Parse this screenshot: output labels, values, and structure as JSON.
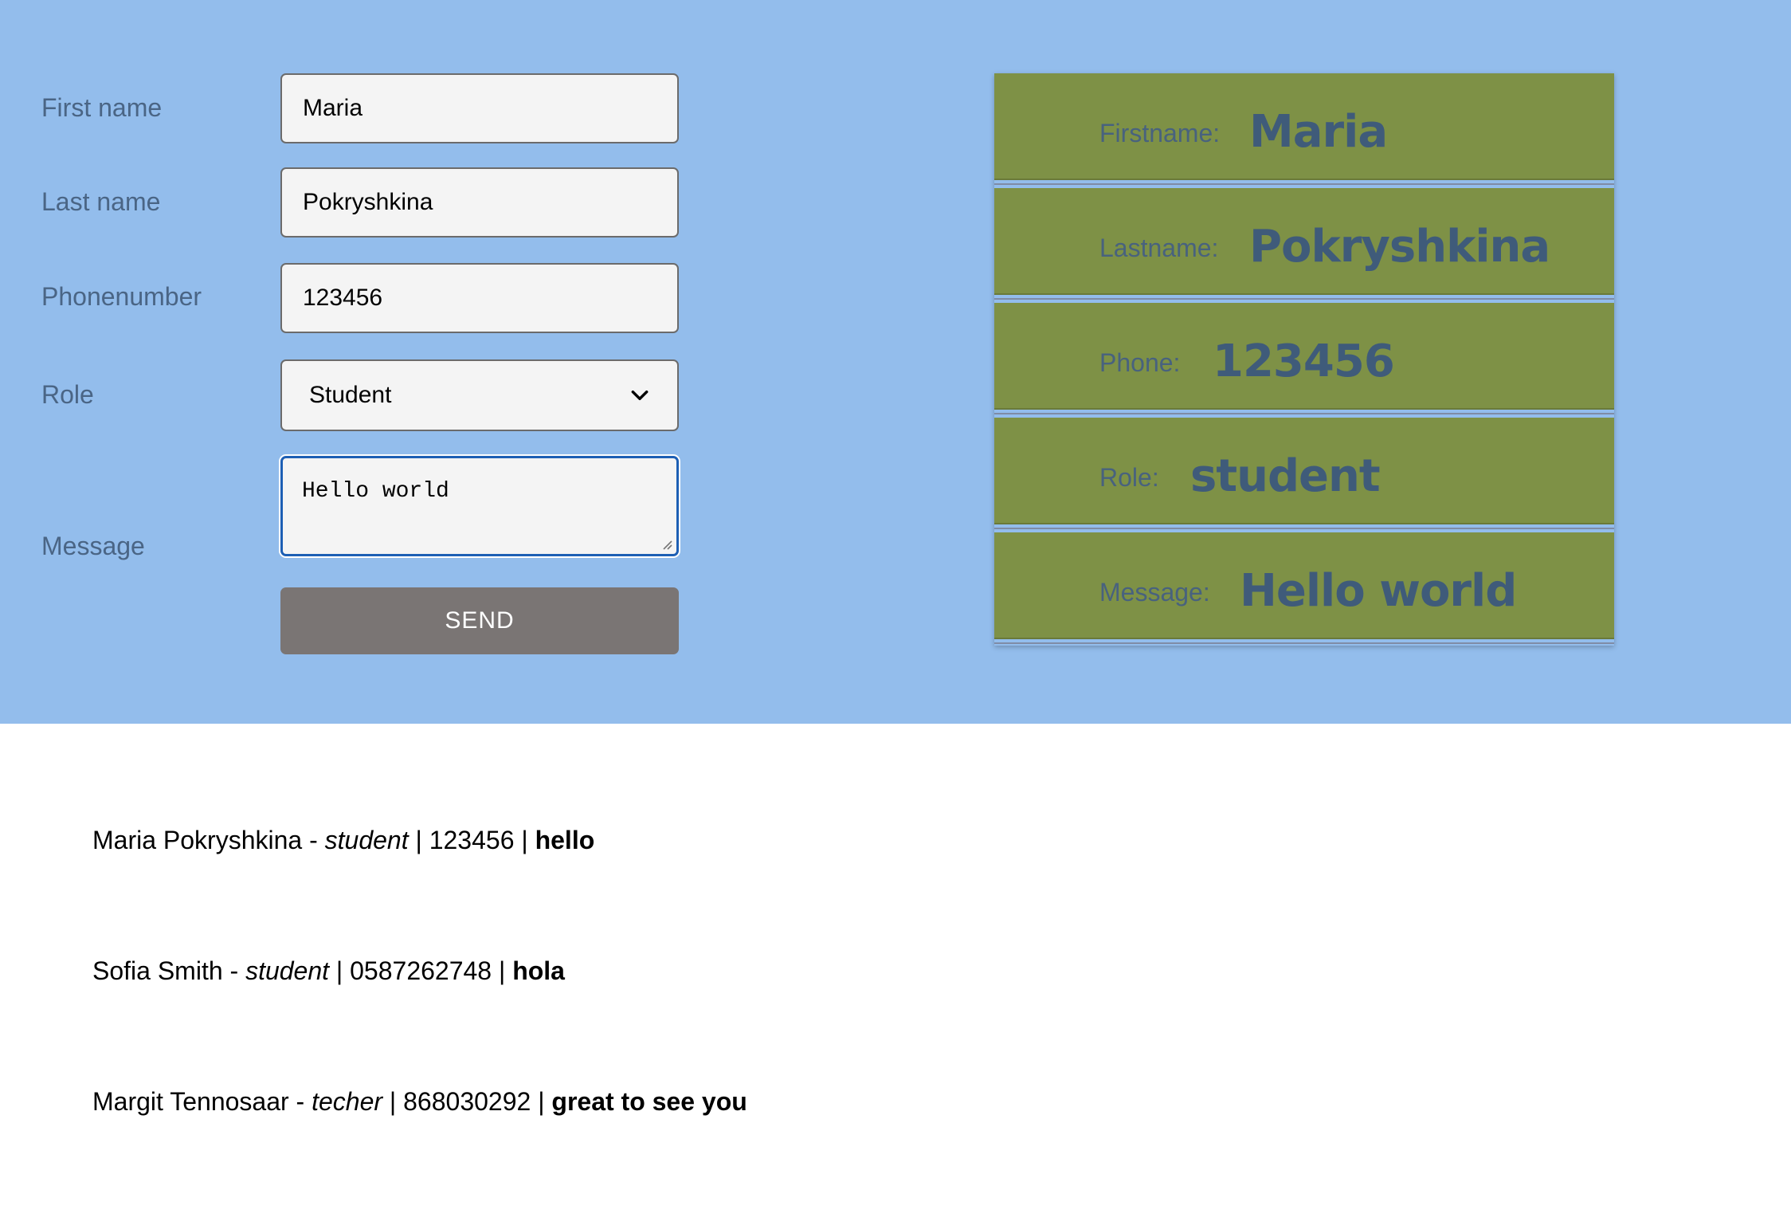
{
  "form": {
    "first_name_label": "First name",
    "first_name_value": "Maria",
    "last_name_label": "Last name",
    "last_name_value": "Pokryshkina",
    "phone_label": "Phonenumber",
    "phone_value": "123456",
    "role_label": "Role",
    "role_value": "Student",
    "message_label": "Message",
    "message_value": "Hello world",
    "send_label": "SEND"
  },
  "preview": {
    "firstname_label": "Firstname:",
    "firstname_value": "Maria",
    "lastname_label": "Lastname:",
    "lastname_value": "Pokryshkina",
    "phone_label": "Phone:",
    "phone_value": "123456",
    "role_label": "Role:",
    "role_value": "student",
    "message_label": "Message:",
    "message_value": "Hello world"
  },
  "entries": [
    {
      "name": "Maria Pokryshkina",
      "role": "student",
      "phone": "123456",
      "message": "hello"
    },
    {
      "name": "Sofia Smith",
      "role": "student",
      "phone": "0587262748",
      "message": "hola"
    },
    {
      "name": "Margit Tennosaar",
      "role": "techer",
      "phone": "868030292",
      "message": "great to see you"
    }
  ],
  "separators": {
    "dash": " - ",
    "bar": " | "
  },
  "colors": {
    "top_background": "#93bdec",
    "card_row": "#7e9146",
    "send_button": "#7a7574",
    "focus_border": "#1d5fb4",
    "label_text": "#4a6585"
  },
  "icons": {
    "select_arrow": "chevron-down-icon",
    "resize": "resize-handle-icon"
  }
}
